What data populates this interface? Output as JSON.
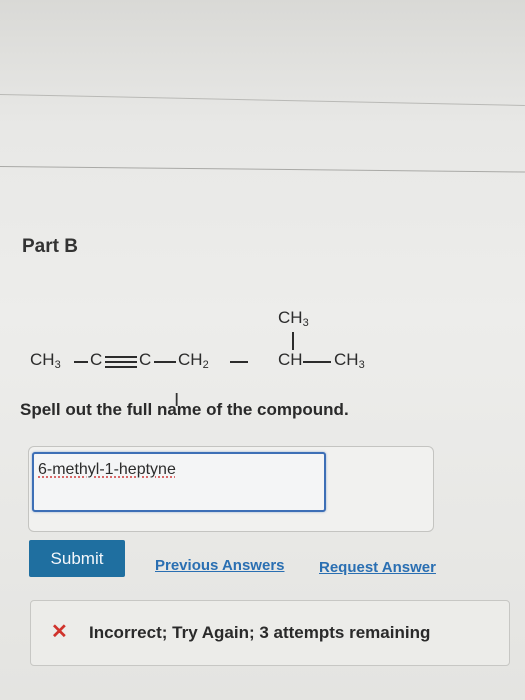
{
  "part": {
    "title": "Part B"
  },
  "structure": {
    "branch": "CH3",
    "chain": [
      "CH3",
      "C",
      "C",
      "CH2",
      "CH",
      "CH3"
    ]
  },
  "question": {
    "text": "Spell out the full name of the compound."
  },
  "answer": {
    "value": "6-methyl-1-heptyne"
  },
  "actions": {
    "submit_label": "Submit",
    "previous_answers_label": "Previous Answers",
    "request_answer_label": "Request Answer"
  },
  "feedback": {
    "icon": "x-icon",
    "text": "Incorrect; Try Again; 3 attempts remaining",
    "color": "#d0332c"
  },
  "colors": {
    "submit_bg": "#1f6fa0",
    "link": "#2a6fb2",
    "input_border": "#3d6fb6"
  }
}
